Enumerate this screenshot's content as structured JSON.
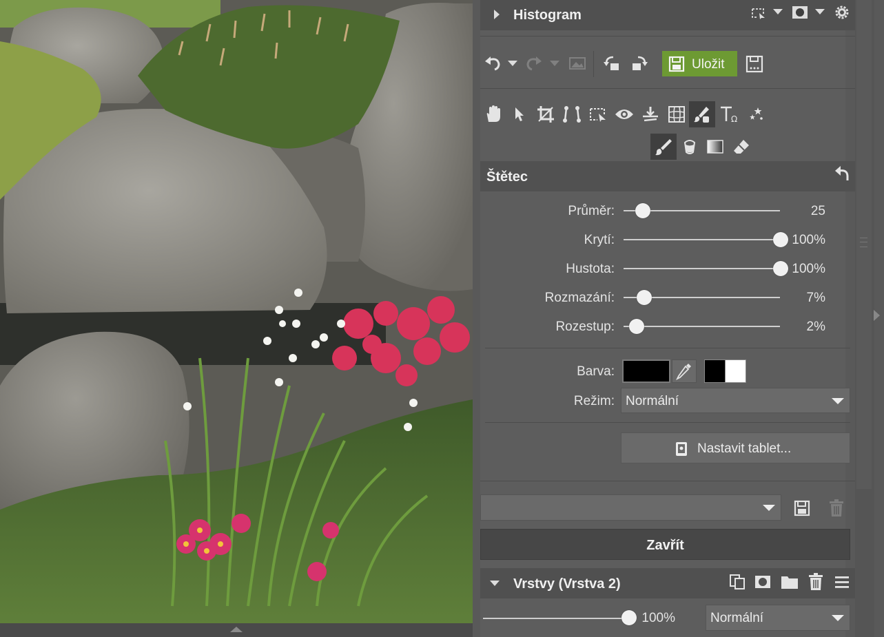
{
  "histogram": {
    "title": "Histogram"
  },
  "toolbar": {
    "save_label": "Uložit"
  },
  "brush": {
    "title": "Štětec",
    "diameter": {
      "label": "Průměr:",
      "value": "25",
      "level": 0.06
    },
    "opacity": {
      "label": "Krytí:",
      "value": "100%",
      "level": 1.0
    },
    "density": {
      "label": "Hustota:",
      "value": "100%",
      "level": 1.0
    },
    "blur": {
      "label": "Rozmazání:",
      "value": "7%",
      "level": 0.07
    },
    "spacing": {
      "label": "Rozestup:",
      "value": "2%",
      "level": 0.02
    },
    "color": {
      "label": "Barva:",
      "value": "#000000"
    },
    "mode": {
      "label": "Režim:",
      "value": "Normální"
    },
    "tablet_button": "Nastavit tablet..."
  },
  "preset": {
    "value": ""
  },
  "close_label": "Zavřít",
  "layers": {
    "title": "Vrstvy (Vrstva 2)",
    "opacity_value": "100%",
    "opacity_level": 1.0,
    "blend_mode": "Normální"
  },
  "colors": {
    "accent_save": "#6d9a33",
    "panel_bg": "#5d5d5d",
    "header_bg": "#505050"
  },
  "icons": [
    "hand-icon",
    "arrow-icon",
    "crop-icon",
    "straighten-icon",
    "selection-icon",
    "eye-icon",
    "level-icon",
    "grid-icon",
    "brush-mask-icon",
    "text-icon",
    "effects-icon",
    "brush-icon",
    "fill-icon",
    "gradient-icon",
    "eraser-icon"
  ]
}
